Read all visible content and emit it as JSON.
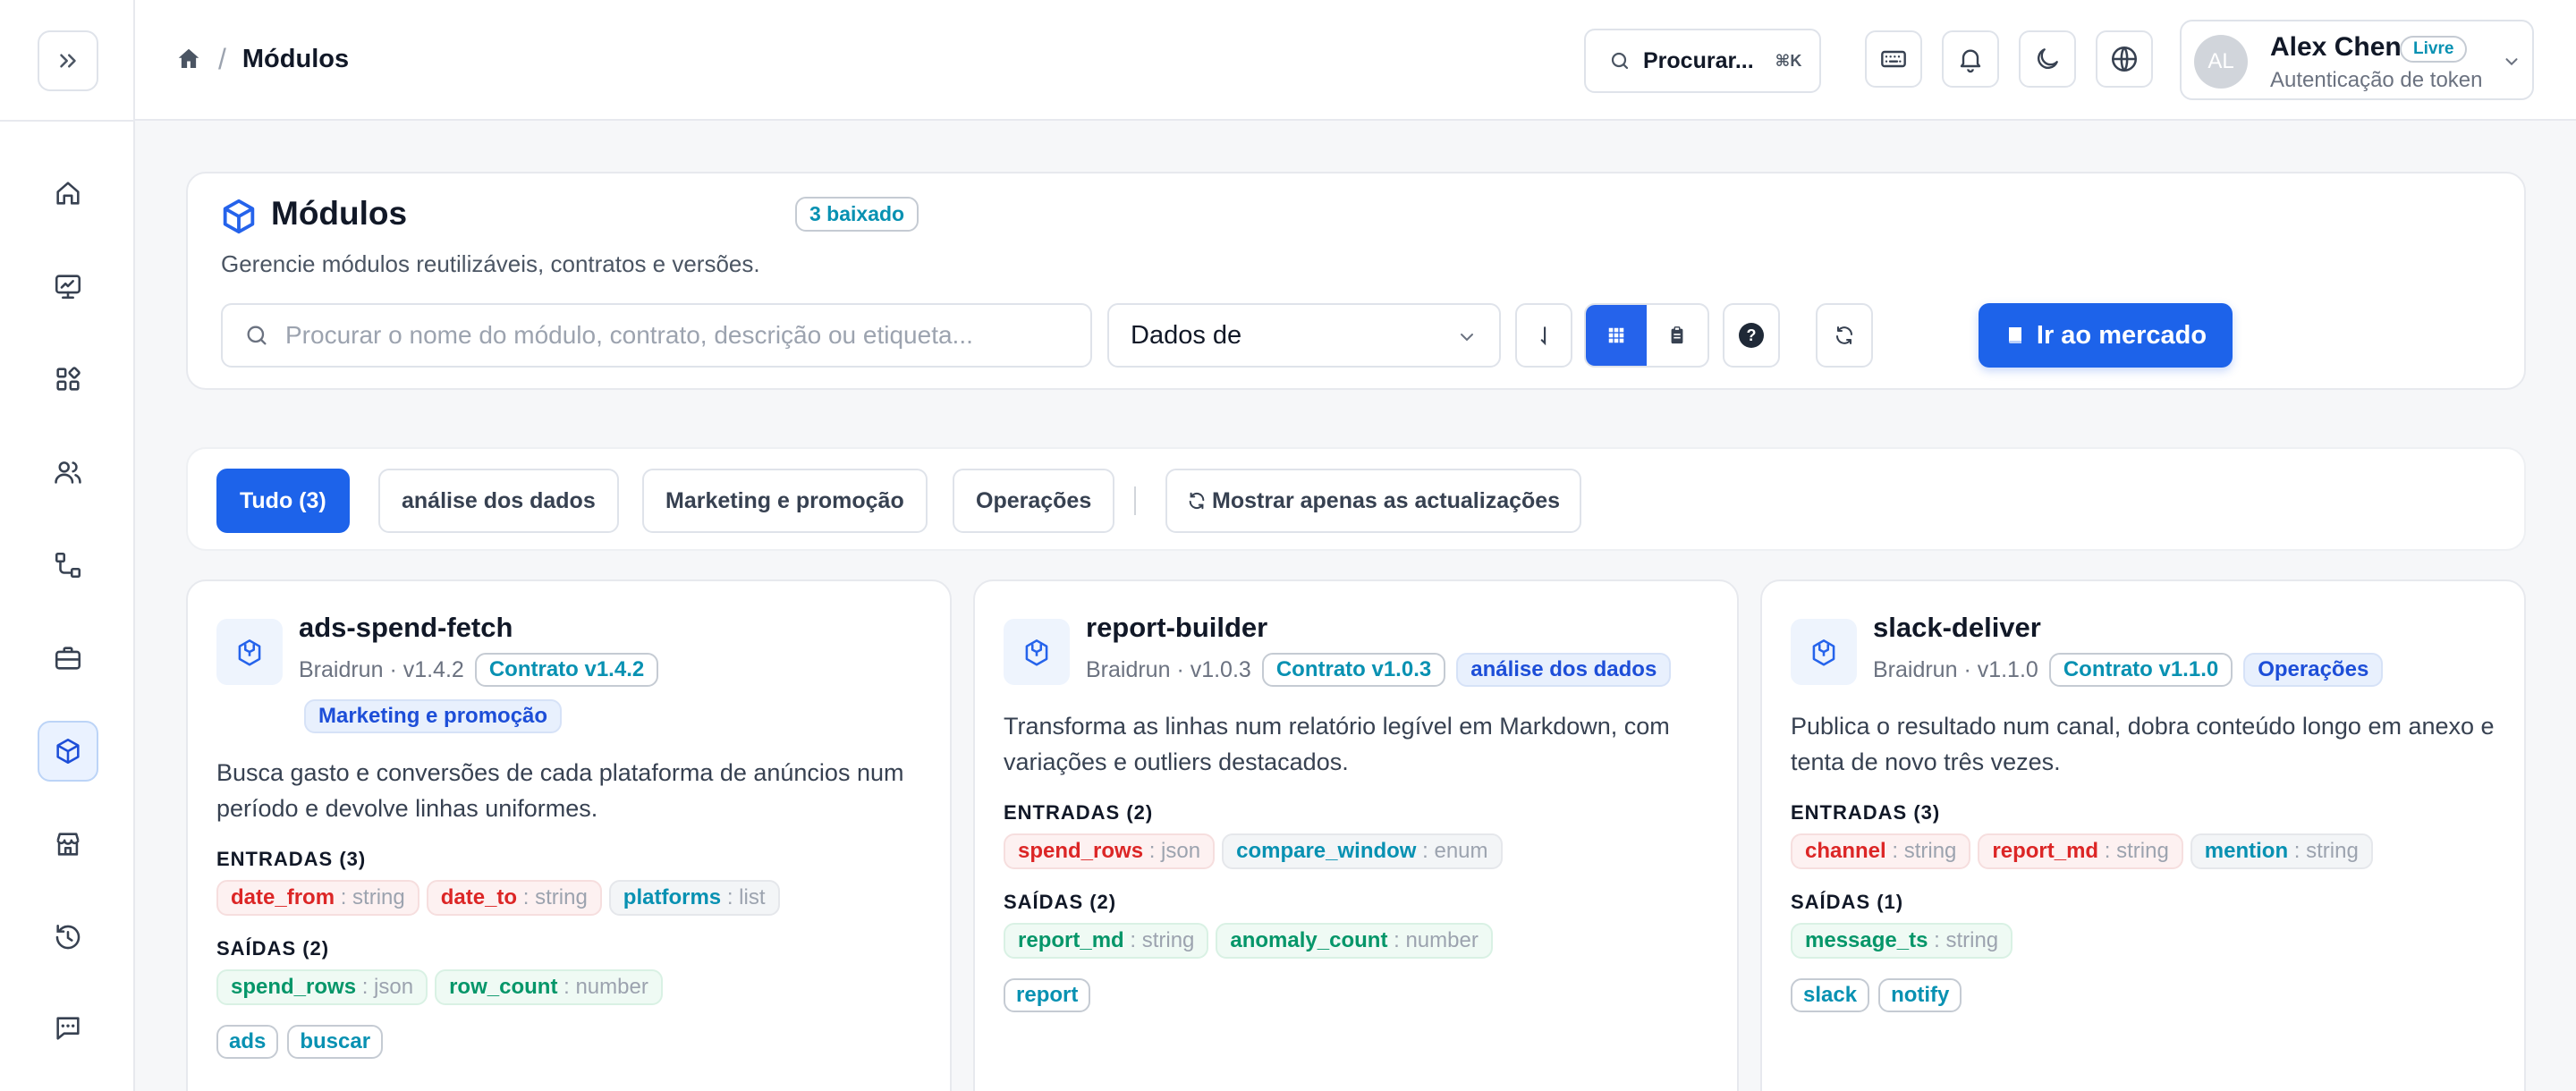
{
  "topbar": {
    "breadcrumb_current": "Módulos",
    "search_label": "Procurar...",
    "search_shortcut": "⌘K"
  },
  "user": {
    "initials": "AL",
    "name": "Alex Chen",
    "plan": "Livre",
    "subtitle": "Autenticação de token"
  },
  "header": {
    "title": "Módulos",
    "count_badge": "3 baixado",
    "description": "Gerencie módulos reutilizáveis, contratos e versões.",
    "search_placeholder": "Procurar o nome do módulo, contrato, descrição ou etiqueta...",
    "select_value": "Dados de",
    "help_glyph": "?",
    "cta_label": "Ir ao mercado"
  },
  "filters": {
    "all": "Tudo (3)",
    "cat1": "análise dos dados",
    "cat2": "Marketing e promoção",
    "cat3": "Operações",
    "updates_only": "Mostrar apenas as actualizações"
  },
  "labels": {
    "inputs": "ENTRADAS",
    "outputs": "SAÍDAS"
  },
  "modules": [
    {
      "name": "ads-spend-fetch",
      "version": "Braidrun · v1.4.2",
      "contract": "Contrato v1.4.2",
      "category": "Marketing e promoção",
      "description": "Busca gasto e conversões de cada plataforma de anúncios num período e devolve linhas uniformes.",
      "inputs_title": "ENTRADAS (3)",
      "inputs": [
        {
          "name": "date_from",
          "type": ": string"
        },
        {
          "name": "date_to",
          "type": ": string"
        },
        {
          "name": "platforms",
          "type": ": list"
        }
      ],
      "outputs_title": "SAÍDAS (2)",
      "outputs": [
        {
          "name": "spend_rows",
          "type": ": json"
        },
        {
          "name": "row_count",
          "type": ": number"
        }
      ],
      "tags": [
        "ads",
        "buscar"
      ]
    },
    {
      "name": "report-builder",
      "version": "Braidrun · v1.0.3",
      "contract": "Contrato v1.0.3",
      "category": "análise dos dados",
      "description": "Transforma as linhas num relatório legível em Markdown, com variações e outliers destacados.",
      "inputs_title": "ENTRADAS (2)",
      "inputs": [
        {
          "name": "spend_rows",
          "type": ": json"
        },
        {
          "name": "compare_window",
          "type": ": enum"
        }
      ],
      "outputs_title": "SAÍDAS (2)",
      "outputs": [
        {
          "name": "report_md",
          "type": ": string"
        },
        {
          "name": "anomaly_count",
          "type": ": number"
        }
      ],
      "tags": [
        "report"
      ]
    },
    {
      "name": "slack-deliver",
      "version": "Braidrun · v1.1.0",
      "contract": "Contrato v1.1.0",
      "category": "Operações",
      "description": "Publica o resultado num canal, dobra conteúdo longo em anexo e tenta de novo três vezes.",
      "inputs_title": "ENTRADAS (3)",
      "inputs": [
        {
          "name": "channel",
          "type": ": string"
        },
        {
          "name": "report_md",
          "type": ": string"
        },
        {
          "name": "mention",
          "type": ": string"
        }
      ],
      "outputs_title": "SAÍDAS (1)",
      "outputs": [
        {
          "name": "message_ts",
          "type": ": string"
        }
      ],
      "tags": [
        "slack",
        "notify"
      ]
    }
  ],
  "colors": {
    "accent": "#1d63ea",
    "input_red": "#dc2626",
    "input_blue": "#0891b2",
    "output_green": "#059669"
  },
  "icons": [
    "expand-sidebar-icon",
    "home-icon",
    "dashboard-icon",
    "apps-icon",
    "users-icon",
    "workflow-icon",
    "briefcase-icon",
    "cube-icon",
    "store-icon",
    "history-icon",
    "chat-icon",
    "search-icon",
    "keyboard-icon",
    "bell-icon",
    "moon-icon",
    "globe-icon",
    "chevron-down-icon",
    "sort-icon",
    "grid-view-icon",
    "list-view-icon",
    "help-icon",
    "refresh-icon",
    "marketplace-icon"
  ]
}
